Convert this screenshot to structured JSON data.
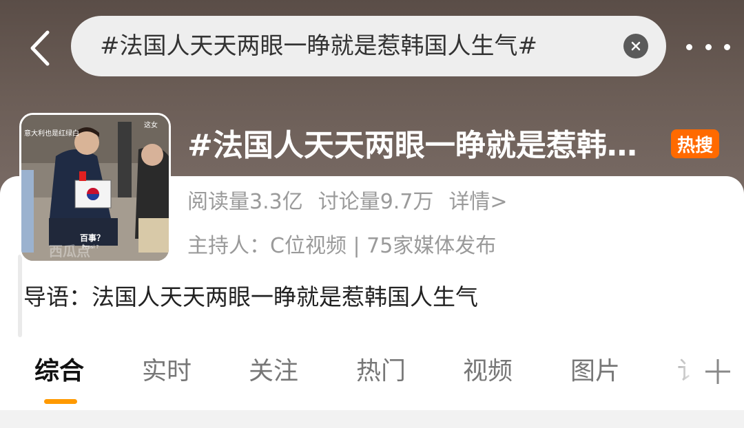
{
  "colors": {
    "accent": "#ff9a00",
    "badge": "#ff6a00",
    "header_bg": "#5a4d47"
  },
  "header": {
    "back_icon": "chevron-left-icon",
    "search_value": "#法国人天天两眼一睁就是惹韩国人生气#",
    "clear_icon": "clear-icon",
    "more_icon": "more-dots-icon"
  },
  "topic": {
    "title": "#法国人天天两眼一睁就是惹韩国人生气#",
    "badge": "热搜",
    "thumbnail": {
      "caption_top": "意大利也是红绿白",
      "caption_right": "这女",
      "label": "百事？",
      "sublabel": "Pepsi ?",
      "watermark": "西瓜点"
    },
    "reads": "阅读量3.3亿",
    "discussions": "讨论量9.7万",
    "details_link": "详情>",
    "host": "主持人：C位视频 | 75家媒体发布",
    "intro": "导语：法国人天天两眼一睁就是惹韩国人生气"
  },
  "tabs": [
    {
      "label": "综合",
      "active": true
    },
    {
      "label": "实时"
    },
    {
      "label": "关注"
    },
    {
      "label": "热门"
    },
    {
      "label": "视频"
    },
    {
      "label": "图片"
    },
    {
      "label": "讠"
    }
  ],
  "add_tab_icon": "plus-icon"
}
